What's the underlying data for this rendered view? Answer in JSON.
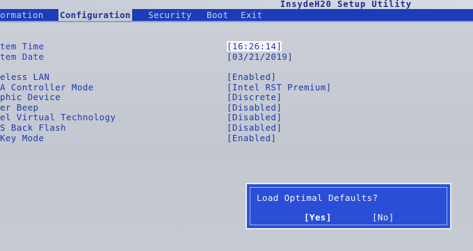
{
  "app_title": "InsydeH20 Setup Utility",
  "tabs": [
    {
      "label": "ormation",
      "active": false
    },
    {
      "label": "Configuration",
      "active": true
    },
    {
      "label": "Security",
      "active": false
    },
    {
      "label": "Boot",
      "active": false
    },
    {
      "label": "Exit",
      "active": false
    }
  ],
  "settings": [
    {
      "label": "tem Time",
      "value": "[16:26:14]"
    },
    {
      "label": "tem Date",
      "value": "[03/21/2019]"
    },
    {
      "label": "eless LAN",
      "value": "[Enabled]"
    },
    {
      "label": "A Controller Mode",
      "value": "[Intel RST Premium]"
    },
    {
      "label": "phic Device",
      "value": "[Discrete]"
    },
    {
      "label": "er Beep",
      "value": "[Disabled]"
    },
    {
      "label": "el Virtual Technology",
      "value": "[Disabled]"
    },
    {
      "label": "S Back Flash",
      "value": "[Disabled]"
    },
    {
      "label": "Key Mode",
      "value": "[Enabled]"
    }
  ],
  "dialog": {
    "message": "Load Optimal Defaults?",
    "yes_label": "[Yes]",
    "no_label": "[No]"
  },
  "colors": {
    "menubar": "#1c3db8",
    "text": "#1c3aa8",
    "dialog": "#2a4fd6",
    "background": "#c9ccd3"
  }
}
